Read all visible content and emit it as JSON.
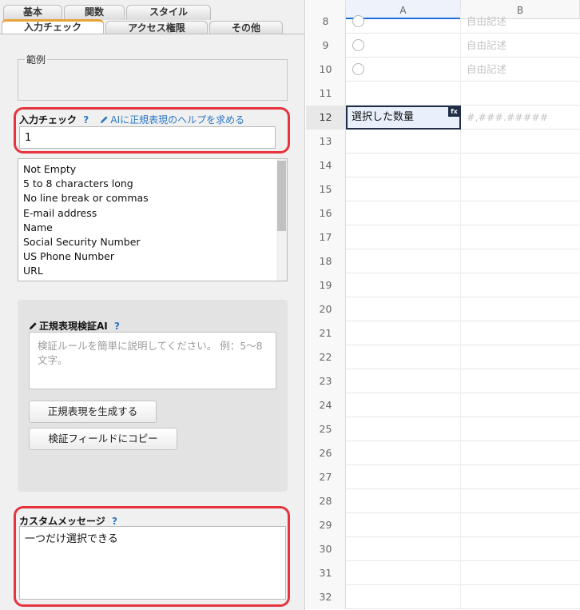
{
  "tabs": {
    "row1": [
      "基本",
      "関数",
      "スタイル"
    ],
    "row2": [
      "入力チェック",
      "アクセス権限",
      "その他"
    ]
  },
  "example": {
    "legend": "範例"
  },
  "validation": {
    "label": "入力チェック",
    "help": "?",
    "ai_link": "AIに正規表現のヘルプを求める",
    "value": "1"
  },
  "rule_list": [
    "Not Empty",
    "5 to 8 characters long",
    "No line break or commas",
    "E-mail address",
    "Name",
    "Social Security Number",
    "US Phone Number",
    "URL"
  ],
  "regex_ai": {
    "title": "正規表現検証AI",
    "help": "?",
    "placeholder": "検証ルールを簡単に説明してください。 例：5〜8文字。",
    "generate_button": "正規表現を生成する",
    "copy_button": "検証フィールドにコピー"
  },
  "custom_message": {
    "label": "カスタムメッセージ",
    "help": "?",
    "value": "一つだけ選択できる"
  },
  "sheet": {
    "columns": [
      "A",
      "B"
    ],
    "rows": [
      {
        "n": "8",
        "radio": true,
        "b": "自由記述"
      },
      {
        "n": "9",
        "radio": true,
        "b": "自由記述"
      },
      {
        "n": "10",
        "radio": true,
        "b": "自由記述"
      },
      {
        "n": "11"
      },
      {
        "n": "12",
        "a": "選択した数量",
        "b": "#,###.#####",
        "active": true
      },
      {
        "n": "13"
      },
      {
        "n": "14"
      },
      {
        "n": "15"
      },
      {
        "n": "16"
      },
      {
        "n": "17"
      },
      {
        "n": "18"
      },
      {
        "n": "19"
      },
      {
        "n": "20"
      },
      {
        "n": "21"
      },
      {
        "n": "22"
      },
      {
        "n": "23"
      },
      {
        "n": "24"
      },
      {
        "n": "25"
      },
      {
        "n": "26"
      },
      {
        "n": "27"
      },
      {
        "n": "28"
      },
      {
        "n": "29"
      },
      {
        "n": "30"
      },
      {
        "n": "31"
      },
      {
        "n": "32"
      }
    ],
    "formula_badge": "fx"
  },
  "colors": {
    "accent": "#2b78c2",
    "highlight": "#e6343f",
    "tab_active": "#e8a33d"
  }
}
